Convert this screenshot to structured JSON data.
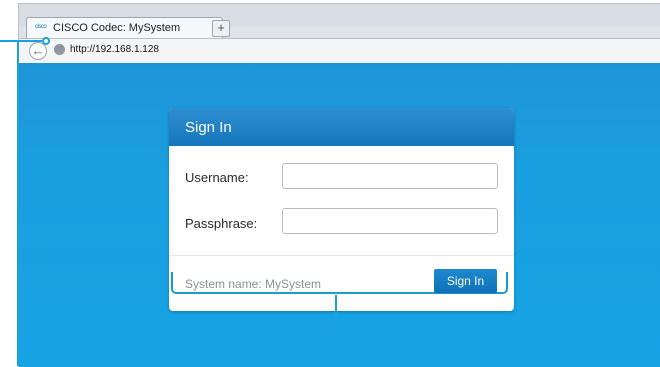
{
  "browser": {
    "tab_title": "CISCO Codec: MySystem",
    "favicon_text": "cisco",
    "new_tab_label": "+",
    "back_symbol": "←",
    "address": "http://192.168.1.128"
  },
  "signin": {
    "title": "Sign In",
    "username_label": "Username:",
    "username_value": "",
    "passphrase_label": "Passphrase:",
    "passphrase_value": "",
    "system_name": "System name: MySystem",
    "button_label": "Sign In"
  },
  "colors": {
    "page_blue": "#1aa0e1",
    "header_blue": "#1576bb",
    "callout_blue": "#1aa1de"
  }
}
